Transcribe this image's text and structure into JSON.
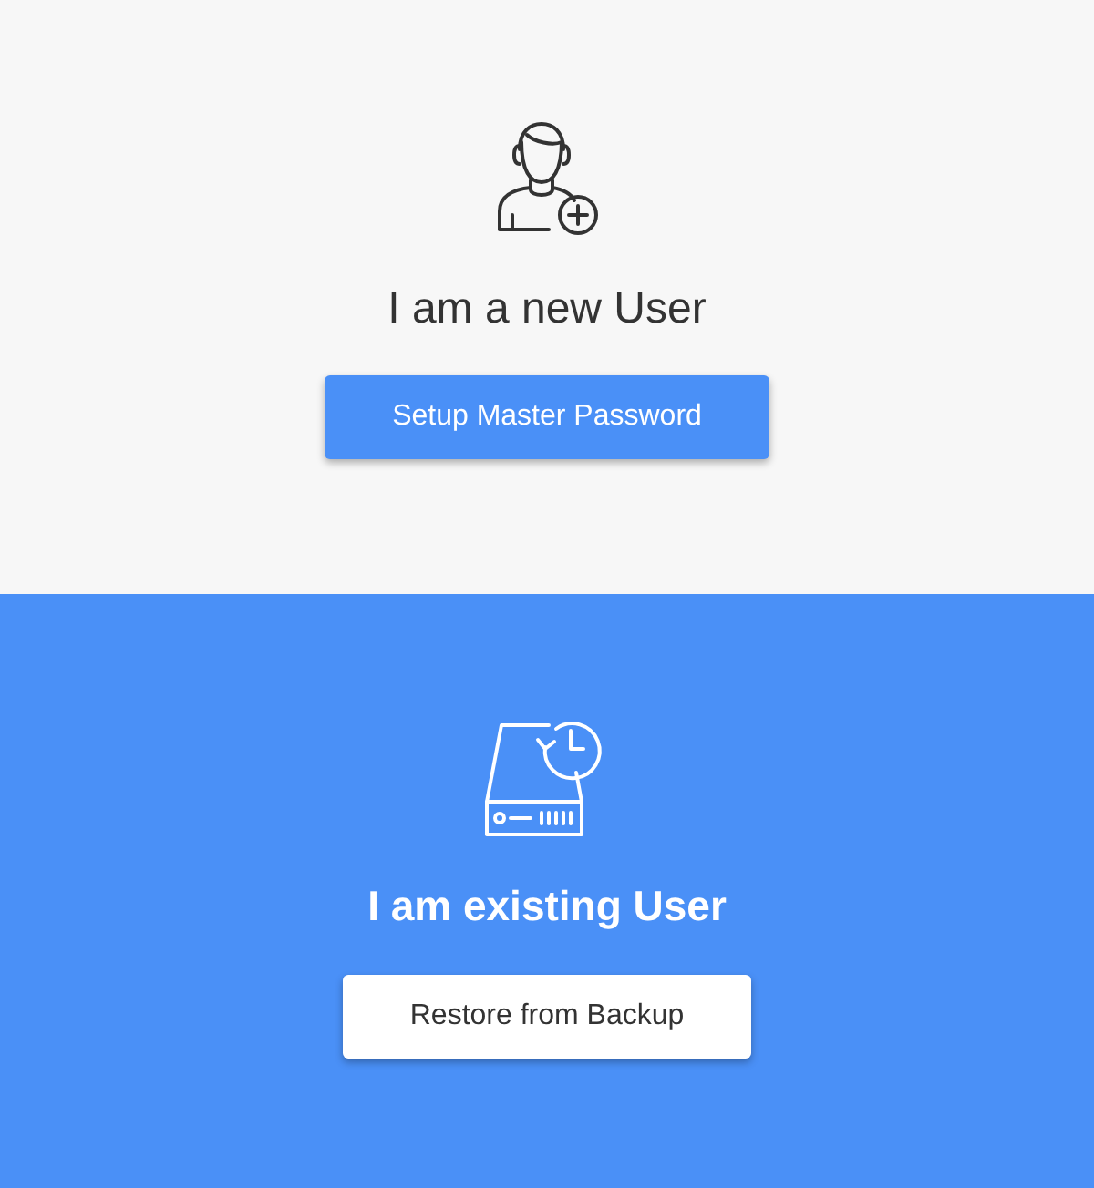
{
  "panels": [
    {
      "kind": "light",
      "title": "I am a new User",
      "button": "Setup Master Password"
    },
    {
      "kind": "dark",
      "title": "I am existing User",
      "button": "Restore from Backup"
    }
  ]
}
